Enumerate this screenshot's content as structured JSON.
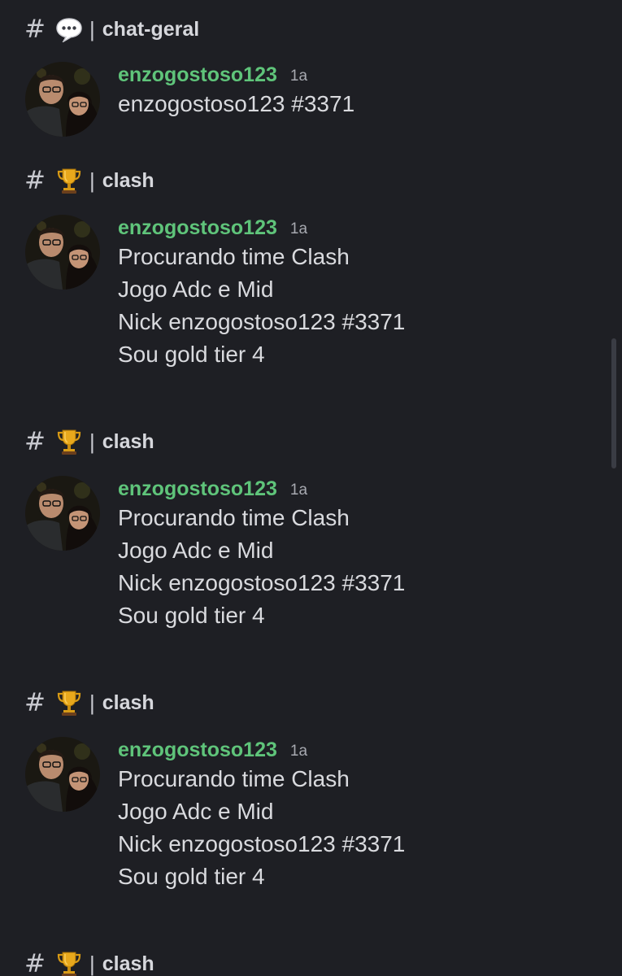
{
  "feed": [
    {
      "channel": {
        "hash": "#",
        "emoji": "speech-balloon-icon",
        "separator": "|",
        "name": "chat-geral"
      },
      "message": {
        "username": "enzogostoso123",
        "timestamp": "1a",
        "lines": [
          "enzogostoso123 #3371"
        ]
      }
    },
    {
      "channel": {
        "hash": "#",
        "emoji": "trophy-icon",
        "separator": "|",
        "name": "clash"
      },
      "message": {
        "username": "enzogostoso123",
        "timestamp": "1a",
        "lines": [
          "Procurando time Clash",
          "Jogo Adc e Mid",
          "Nick enzogostoso123 #3371",
          "Sou gold tier 4"
        ]
      }
    },
    {
      "channel": {
        "hash": "#",
        "emoji": "trophy-icon",
        "separator": "|",
        "name": "clash"
      },
      "message": {
        "username": "enzogostoso123",
        "timestamp": "1a",
        "lines": [
          "Procurando time Clash",
          "Jogo Adc e Mid",
          "Nick enzogostoso123 #3371",
          "Sou gold tier 4"
        ]
      }
    },
    {
      "channel": {
        "hash": "#",
        "emoji": "trophy-icon",
        "separator": "|",
        "name": "clash"
      },
      "message": {
        "username": "enzogostoso123",
        "timestamp": "1a",
        "lines": [
          "Procurando time Clash",
          "Jogo Adc e Mid",
          "Nick enzogostoso123 #3371",
          "Sou gold tier 4"
        ]
      }
    },
    {
      "channel": {
        "hash": "#",
        "emoji": "trophy-icon",
        "separator": "|",
        "name": "clash"
      }
    }
  ],
  "colors": {
    "background": "#1e1f24",
    "username": "#5fc47a",
    "text": "#d9dade",
    "muted": "#a7a9b0"
  }
}
